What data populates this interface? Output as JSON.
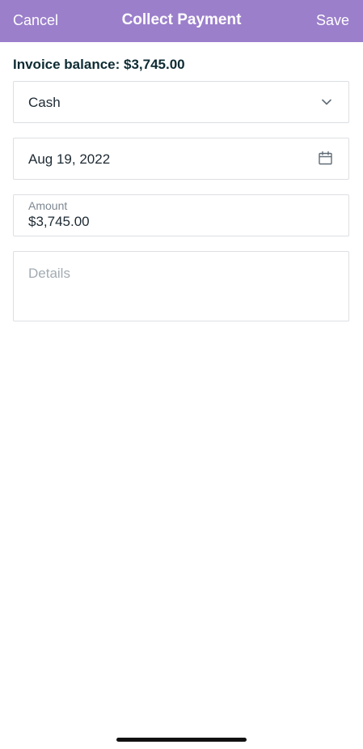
{
  "navbar": {
    "cancel_label": "Cancel",
    "title": "Collect Payment",
    "save_label": "Save",
    "background_color": "#9b7fcb"
  },
  "invoice": {
    "balance_text": "Invoice balance: $3,745.00"
  },
  "payment_method": {
    "selected": "Cash",
    "icon": "chevron-down-icon"
  },
  "payment_date": {
    "value": "Aug 19, 2022",
    "icon": "calendar-icon"
  },
  "amount": {
    "label": "Amount",
    "value": "$3,745.00"
  },
  "details": {
    "placeholder": "Details",
    "value": ""
  }
}
